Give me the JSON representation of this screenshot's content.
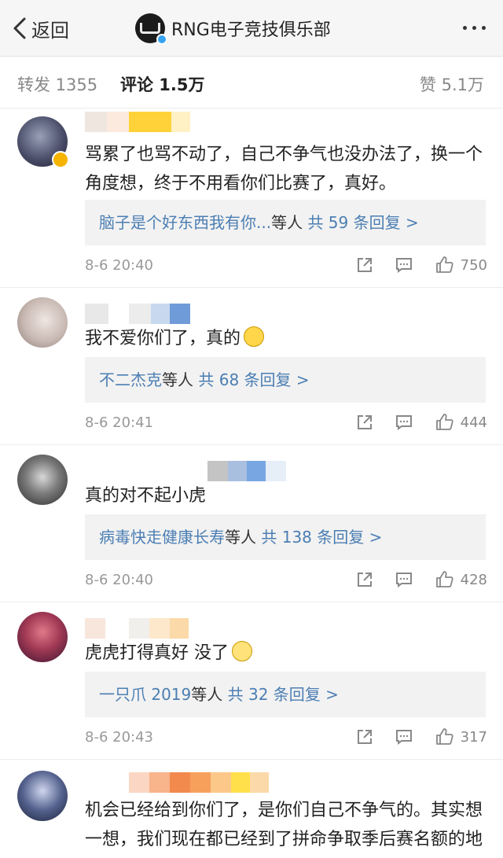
{
  "header": {
    "back_label": "返回",
    "title": "RNG电子竞技俱乐部"
  },
  "tabs": {
    "repost": "转发 1355",
    "comment": "评论 1.5万",
    "like": "赞 5.1万"
  },
  "comments": [
    {
      "text": "骂累了也骂不动了，自己不争气也没办法了，换一个角度想，终于不用看你们比赛了，真好。",
      "reply_users": "脑子是个好东西我有你...",
      "reply_suffix": "等人",
      "reply_total": "共 59 条回复 >",
      "time": "8-6 20:40",
      "likes": "750"
    },
    {
      "text": "我不爱你们了，真的",
      "emoji": "crying-laughing-emoji",
      "reply_users": "不二杰克",
      "reply_suffix": "等人",
      "reply_total": "共 68 条回复 >",
      "time": "8-6 20:41",
      "likes": "444"
    },
    {
      "text": "真的对不起小虎",
      "reply_users": "病毒快走健康长寿",
      "reply_suffix": "等人",
      "reply_total": "共 138 条回复 >",
      "time": "8-6 20:40",
      "likes": "428"
    },
    {
      "text": "虎虎打得真好 没了",
      "emoji": "smile-emoji",
      "reply_users": "一只爪 2019",
      "reply_suffix": "等人",
      "reply_total": "共 32 条回复 >",
      "time": "8-6 20:43",
      "likes": "317"
    },
    {
      "text": "机会已经给到你们了，是你们自己不争气的。其实想一想，我们现在都已经到了拼命争取季后赛名额的地步了吗？"
    }
  ],
  "colors": {
    "link": "#4b7eb3",
    "reply_bg": "#f2f2f2",
    "verify_blue": "#36a2f0",
    "vip_gold": "#f5b400"
  }
}
